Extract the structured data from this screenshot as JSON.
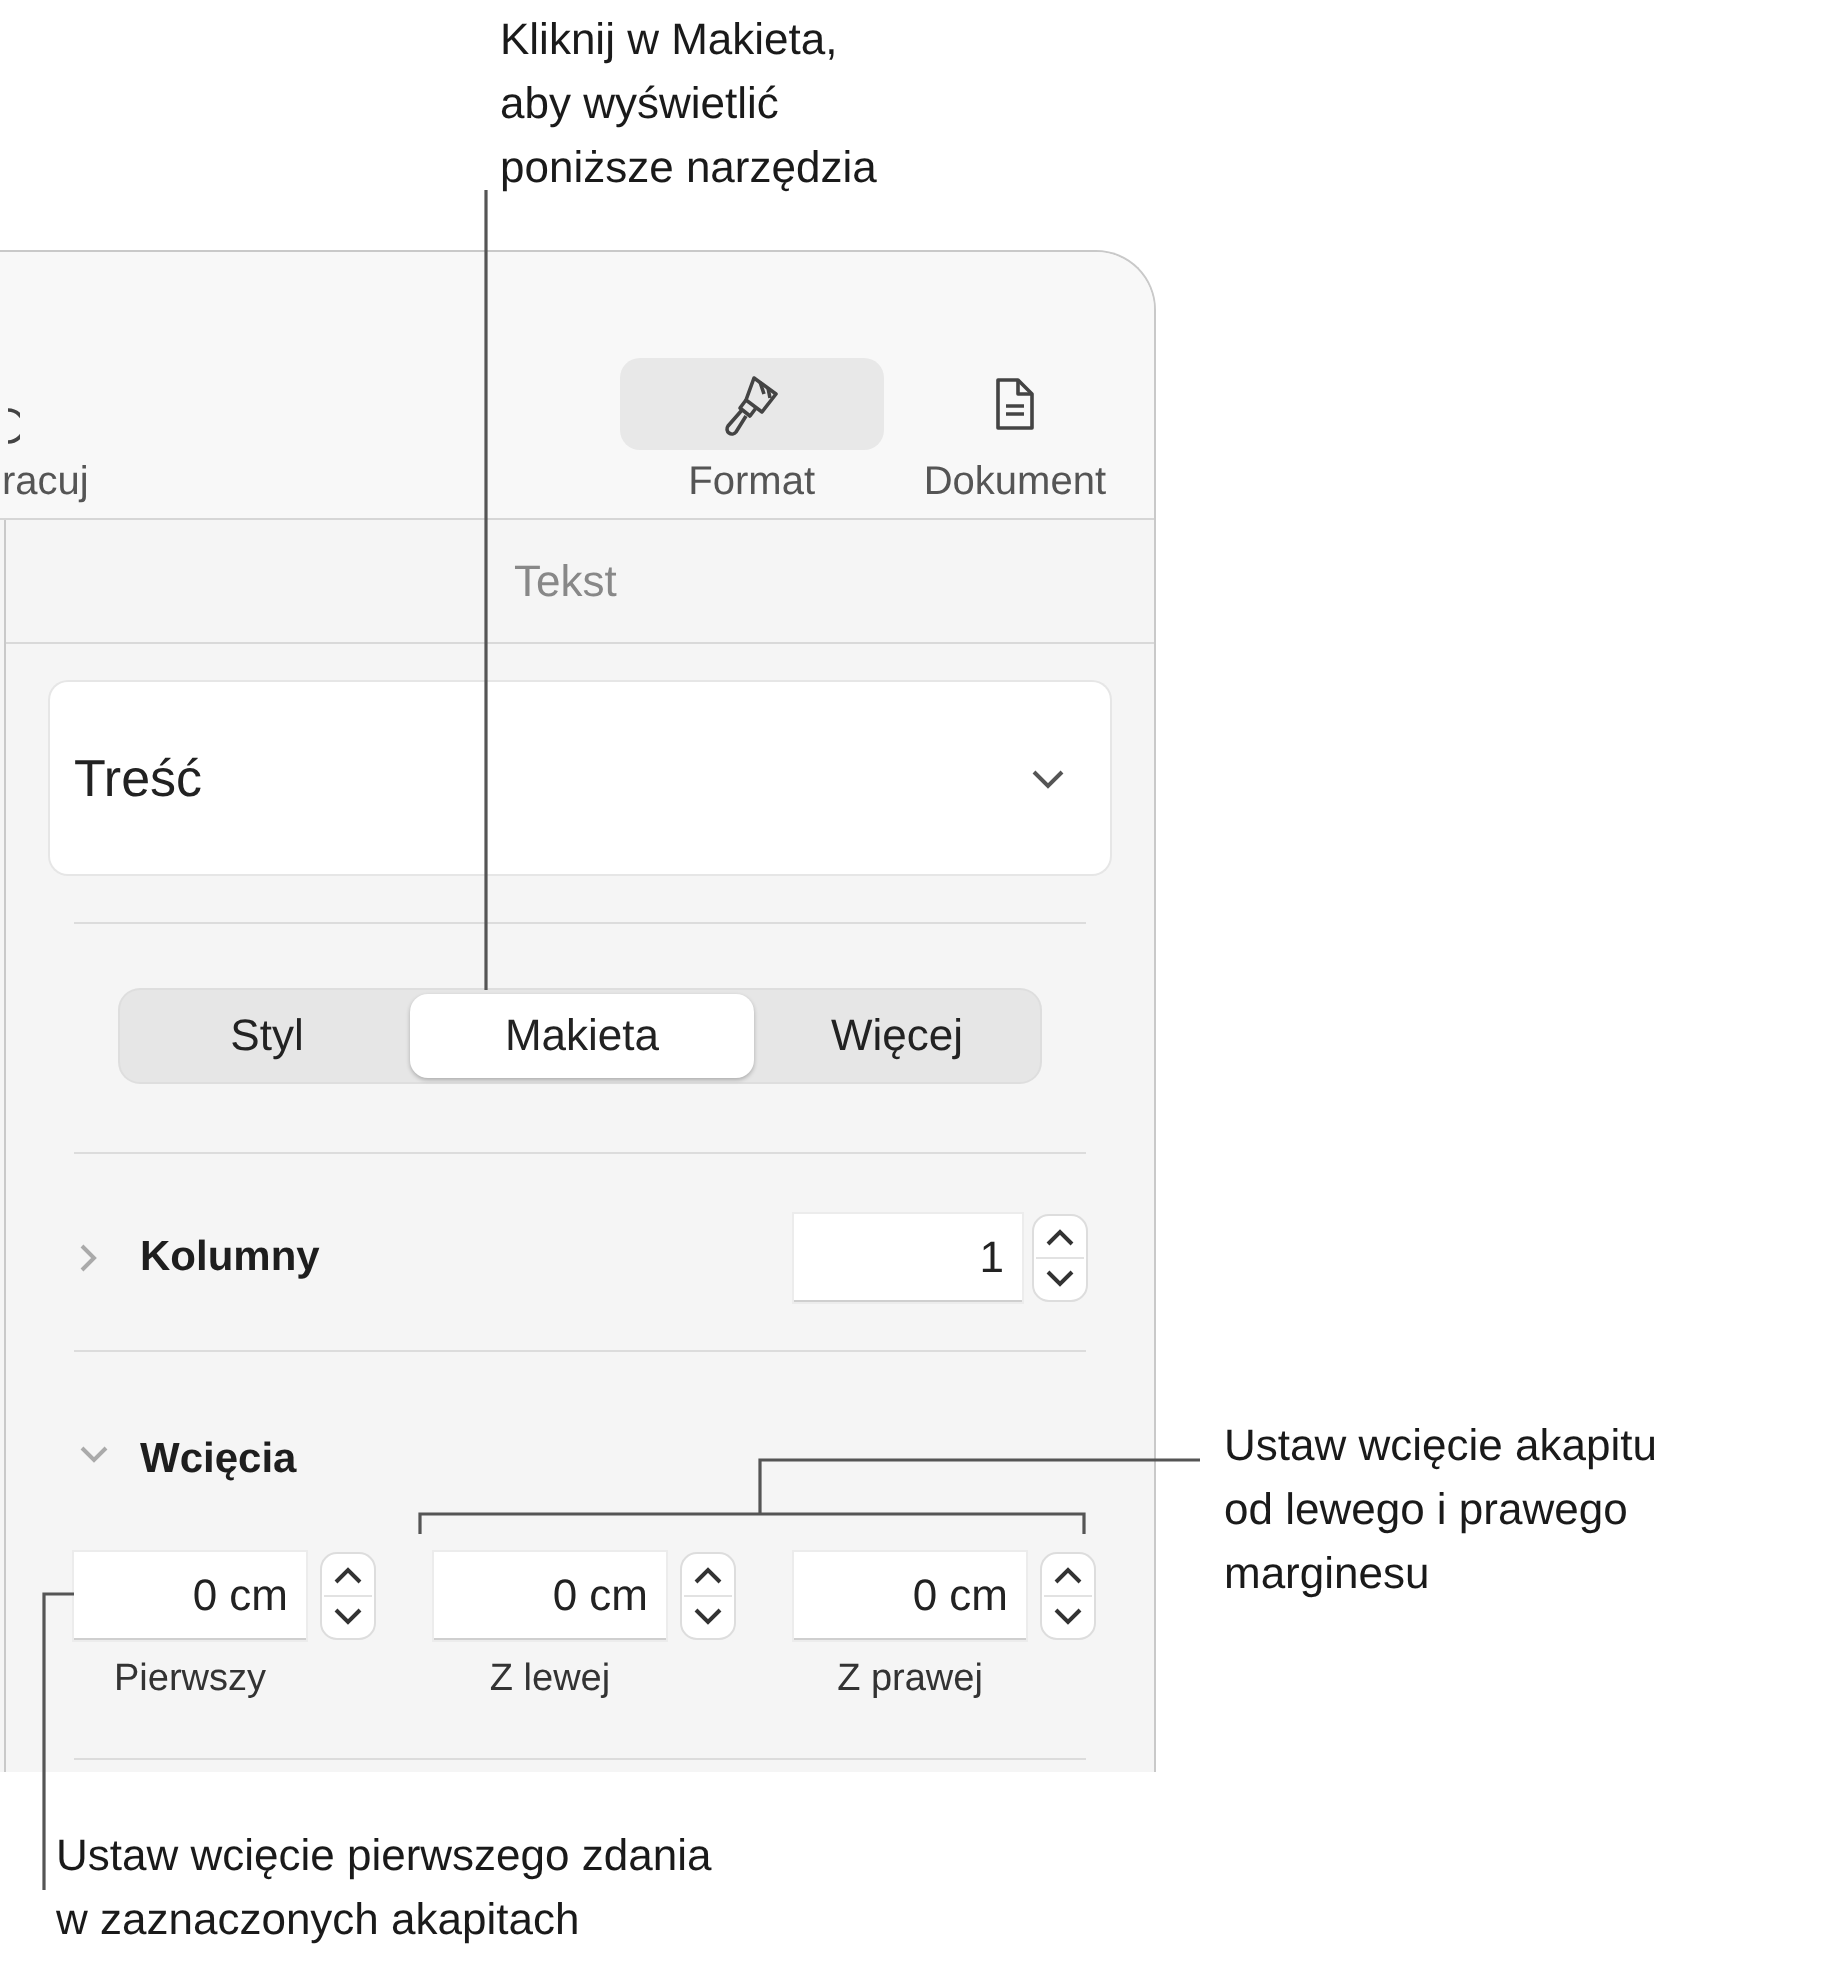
{
  "toolbar": {
    "partial_label": "racuj",
    "buttons": [
      {
        "kind": "format",
        "label": "Format",
        "selected": true
      },
      {
        "kind": "document",
        "label": "Dokument",
        "selected": false
      }
    ]
  },
  "section_title": "Tekst",
  "paragraph_style": "Treść",
  "tabs": [
    {
      "label": "Styl",
      "selected": false
    },
    {
      "label": "Makieta",
      "selected": true
    },
    {
      "label": "Więcej",
      "selected": false
    }
  ],
  "columns": {
    "label": "Kolumny",
    "expanded": false,
    "value": "1"
  },
  "indents": {
    "label": "Wcięcia",
    "expanded": true,
    "fields": [
      {
        "value": "0 cm",
        "label": "Pierwszy"
      },
      {
        "value": "0 cm",
        "label": "Z lewej"
      },
      {
        "value": "0 cm",
        "label": "Z prawej"
      }
    ]
  },
  "callouts": [
    {
      "kind": "top",
      "text": "Kliknij w Makieta,\naby wyświetlić\nponiższe narzędzia"
    },
    {
      "kind": "right",
      "text": "Ustaw wcięcie akapitu\nod lewego i prawego\nmarginesu"
    },
    {
      "kind": "bottom",
      "text": "Ustaw wcięcie pierwszego zdania\nw zaznaczonych akapitach"
    }
  ]
}
